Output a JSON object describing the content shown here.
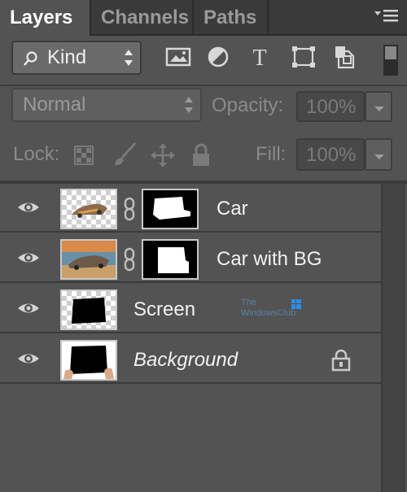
{
  "tabs": [
    {
      "label": "Layers",
      "active": true
    },
    {
      "label": "Channels",
      "active": false
    },
    {
      "label": "Paths",
      "active": false
    }
  ],
  "filter": {
    "kind_label": "Kind",
    "icons": [
      "image-filter-icon",
      "adjustment-filter-icon",
      "type-filter-icon",
      "shape-filter-icon",
      "smart-object-filter-icon"
    ]
  },
  "blend": {
    "mode": "Normal",
    "opacity_label": "Opacity:",
    "opacity_value": "100%"
  },
  "lock": {
    "label": "Lock:",
    "fill_label": "Fill:",
    "fill_value": "100%"
  },
  "layers": [
    {
      "name": "Car",
      "italic": false,
      "has_mask": true,
      "locked": false
    },
    {
      "name": "Car with BG",
      "italic": false,
      "has_mask": true,
      "locked": false
    },
    {
      "name": "Screen",
      "italic": false,
      "has_mask": false,
      "locked": false
    },
    {
      "name": "Background",
      "italic": true,
      "has_mask": false,
      "locked": true
    }
  ],
  "watermark": {
    "line1": "The",
    "line2": "WindowsClub"
  },
  "colors": {
    "panel": "#535353",
    "tabbar": "#3a3a3a",
    "accent_watermark": "#1e90ff"
  }
}
